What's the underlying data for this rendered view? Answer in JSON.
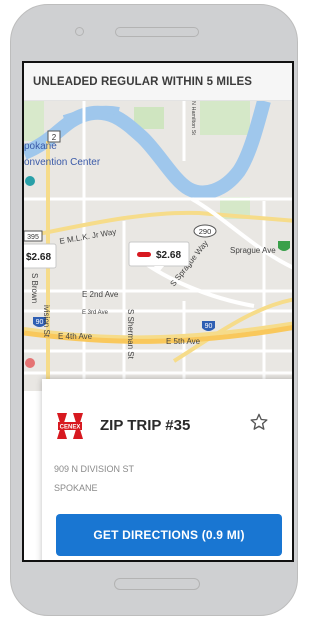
{
  "header": {
    "title": "UNLEADED REGULAR WITHIN 5 MILES"
  },
  "map": {
    "labels": {
      "spokane": "pokane",
      "convention_center": "onvention Center",
      "mlk_way": "E M.L.K. Jr Way",
      "second_ave": "E 2nd Ave",
      "third_ave": "E 3rd Ave",
      "fourth_ave": "E 4th Ave",
      "fifth_ave": "E 5th Ave",
      "sprague_ave": "Sprague Ave",
      "s_sprague_way": "S Sprague Way",
      "s_sherman_st": "S Sherman St",
      "s_browne": "S Brown",
      "division_st": "ivision St",
      "hamilton_st": "N Hamilton St",
      "route_2": "2",
      "route_290": "290",
      "route_395": "395",
      "route_90_left": "90",
      "route_90_right": "90"
    },
    "markers": [
      {
        "price": "$2.68",
        "icon": "gas-station-icon",
        "selected": true
      },
      {
        "price": "$2.68",
        "icon": "none",
        "selected": false
      }
    ]
  },
  "card": {
    "brand": "CENEX",
    "station_name": "ZIP TRIP #35",
    "address_line1": "909 N DIVISION ST",
    "address_line2": "SPOKANE",
    "directions_label": "GET DIRECTIONS (0.9 MI)",
    "favorite_icon": "star-outline-icon"
  },
  "colors": {
    "accent": "#1976d2",
    "brand_red": "#d71920"
  }
}
